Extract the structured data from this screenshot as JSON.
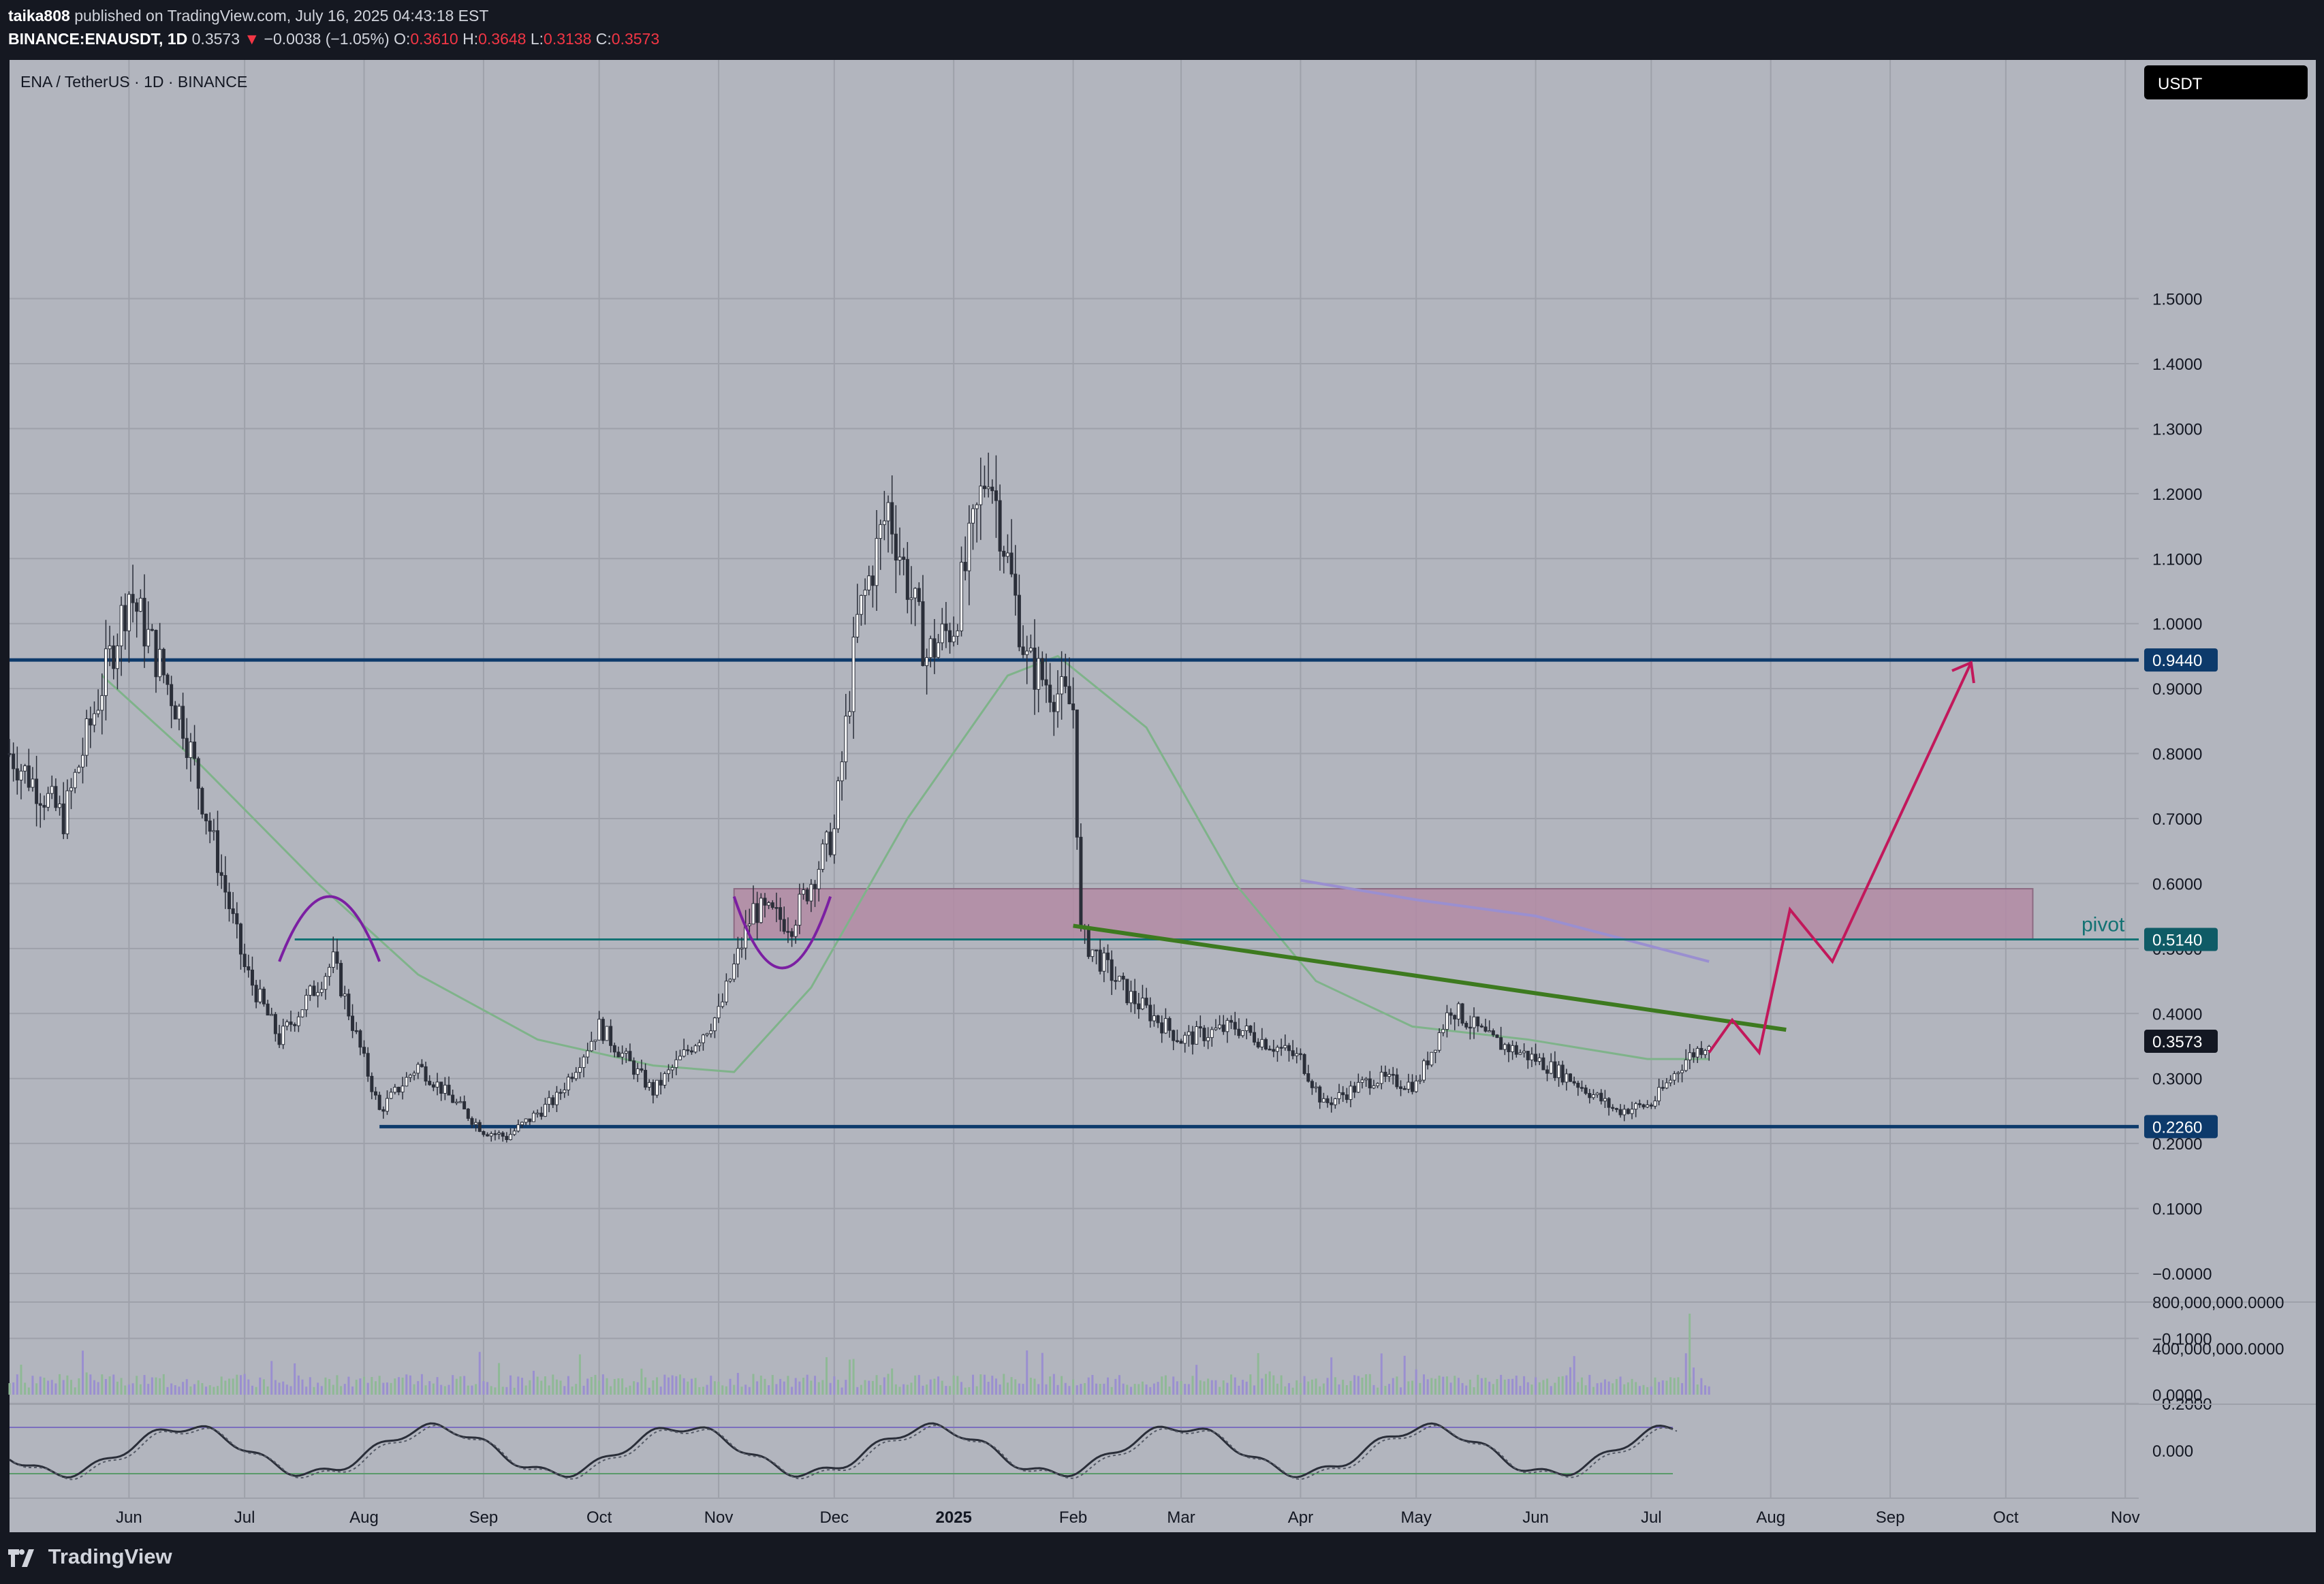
{
  "header": {
    "author": "taika808",
    "published_text": "published on TradingView.com, July 16, 2025 04:43:18 EST",
    "symbol": "BINANCE:ENAUSDT, 1D",
    "last_price": "0.3573",
    "change_arrow": "▼",
    "change": "−0.0038 (−1.05%)",
    "o_label": "O:",
    "o_value": "0.3610",
    "h_label": "H:",
    "h_value": "0.3648",
    "l_label": "L:",
    "l_value": "0.3138",
    "c_label": "C:",
    "c_value": "0.3573"
  },
  "chart_title": "ENA / TetherUS · 1D · BINANCE",
  "currency_badge": "USDT",
  "brand": "TradingView",
  "colors": {
    "chart_bg": "#b2b5be",
    "page_bg": "#151821",
    "level_line": "#0d3a6b",
    "pivot_line": "#137273",
    "trendline": "#3d7a1f",
    "projection": "#c2185b",
    "zone": "#b38ba4",
    "arc": "#7b1fa2",
    "ma_green": "#7fb38a",
    "ma_purple": "#9a8fd0"
  },
  "chart_data": [
    {
      "type": "line",
      "subtype": "candlestick",
      "title": "ENA / TetherUS · 1D · BINANCE",
      "x": [
        "2024-05-01",
        "2024-05-15",
        "2024-06-01",
        "2024-06-15",
        "2024-07-01",
        "2024-07-10",
        "2024-07-24",
        "2024-08-05",
        "2024-08-15",
        "2024-09-01",
        "2024-09-07",
        "2024-09-20",
        "2024-10-01",
        "2024-10-15",
        "2024-11-01",
        "2024-11-10",
        "2024-11-20",
        "2024-12-01",
        "2024-12-07",
        "2024-12-15",
        "2024-12-25",
        "2025-01-01",
        "2025-01-10",
        "2025-01-20",
        "2025-02-01",
        "2025-02-03",
        "2025-02-15",
        "2025-03-01",
        "2025-03-15",
        "2025-04-01",
        "2025-04-07",
        "2025-04-20",
        "2025-05-01",
        "2025-05-10",
        "2025-05-20",
        "2025-06-01",
        "2025-06-10",
        "2025-06-22",
        "2025-07-01",
        "2025-07-10",
        "2025-07-16"
      ],
      "close": [
        0.8,
        0.7,
        1.05,
        0.85,
        0.47,
        0.36,
        0.48,
        0.25,
        0.32,
        0.22,
        0.21,
        0.27,
        0.38,
        0.28,
        0.4,
        0.56,
        0.54,
        0.68,
        1.0,
        1.18,
        0.95,
        1.0,
        1.25,
        0.94,
        0.87,
        0.52,
        0.43,
        0.36,
        0.38,
        0.33,
        0.26,
        0.3,
        0.29,
        0.41,
        0.36,
        0.33,
        0.3,
        0.25,
        0.26,
        0.33,
        0.3573
      ],
      "ylim": [
        -0.25,
        1.6
      ],
      "yticks": [
        "1.5000",
        "1.4000",
        "1.3000",
        "1.2000",
        "1.1000",
        "1.0000",
        "0.9000",
        "0.8000",
        "0.7000",
        "0.6000",
        "0.5000",
        "0.4000",
        "0.3000",
        "0.2000",
        "0.1000",
        "−0.0000",
        "−0.1000",
        "−0.2000"
      ],
      "xticks": [
        "Jun",
        "Jul",
        "Aug",
        "Sep",
        "Oct",
        "Nov",
        "Dec",
        "2025",
        "Feb",
        "Mar",
        "Apr",
        "May",
        "Jun",
        "Jul",
        "Aug",
        "Sep",
        "Oct",
        "Nov"
      ],
      "levels": [
        {
          "label": "0.9440",
          "value": 0.944
        },
        {
          "label": "0.5140",
          "value": 0.514,
          "annotation": "pivot"
        },
        {
          "label": "0.3573",
          "value": 0.3573
        },
        {
          "label": "0.2260",
          "value": 0.226
        }
      ],
      "zone": {
        "x_start": "2024-11-05",
        "x_end": "2025-10-08",
        "y_low": 0.514,
        "y_high": 0.592
      },
      "trendline": {
        "x": [
          "2025-02-01",
          "2025-08-05"
        ],
        "y": [
          0.535,
          0.375
        ]
      },
      "projection": {
        "x": [
          "2025-07-16",
          "2025-07-22",
          "2025-07-29",
          "2025-08-06",
          "2025-08-17",
          "2025-09-22"
        ],
        "y": [
          0.34,
          0.39,
          0.34,
          0.56,
          0.48,
          0.94
        ]
      },
      "grid": true
    },
    {
      "type": "bar",
      "title": "Volume",
      "yticks": [
        "800,000,000.0000",
        "400,000,000.0000",
        "0.0000"
      ],
      "ylim": [
        0,
        800000000
      ],
      "peak": 700000000
    },
    {
      "type": "line",
      "title": "Oscillator",
      "yticks": [
        "0.000"
      ]
    }
  ]
}
